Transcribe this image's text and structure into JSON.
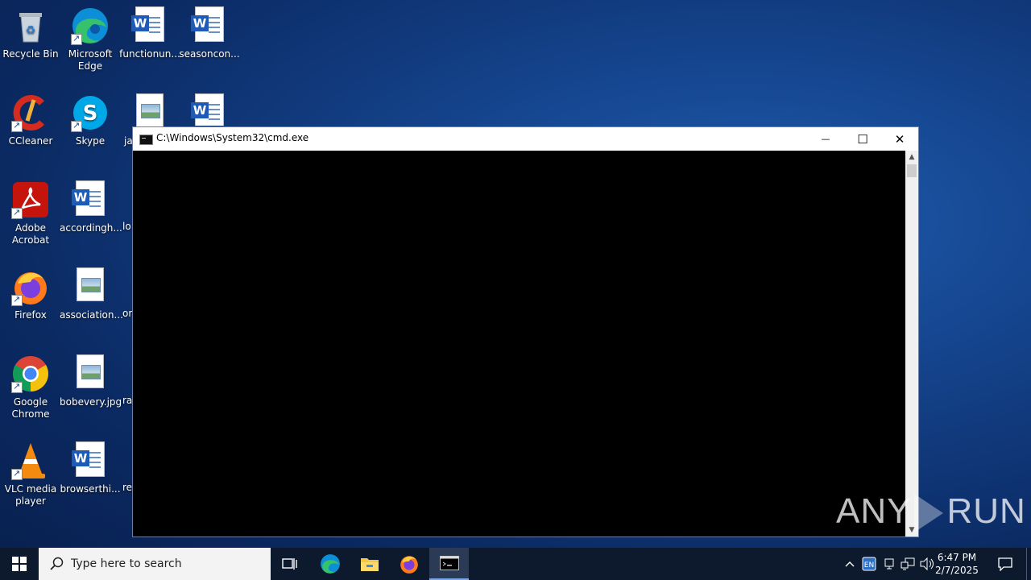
{
  "desktop": {
    "icons": [
      {
        "label": "Recycle Bin"
      },
      {
        "label": "Microsoft Edge"
      },
      {
        "label": "functionun..."
      },
      {
        "label": "seasoncon..."
      },
      {
        "label": "CCleaner"
      },
      {
        "label": "Skype"
      },
      {
        "label": "ja"
      },
      {
        "label": "Adobe Acrobat"
      },
      {
        "label": "accordingh..."
      },
      {
        "label": "lo"
      },
      {
        "label": "Firefox"
      },
      {
        "label": "association..."
      },
      {
        "label": "or"
      },
      {
        "label": "Google Chrome"
      },
      {
        "label": "bobevery.jpg"
      },
      {
        "label": "ra"
      },
      {
        "label": "VLC media player"
      },
      {
        "label": "browserthi..."
      },
      {
        "label": "re"
      }
    ]
  },
  "cmd_window": {
    "title": "C:\\Windows\\System32\\cmd.exe",
    "minimize_glyph": "—",
    "maximize_glyph": "☐",
    "close_glyph": "✕"
  },
  "watermark": {
    "left": "ANY",
    "right": "RUN"
  },
  "taskbar": {
    "search_placeholder": "Type here to search",
    "time": "6:47 PM",
    "date": "2/7/2025",
    "pinned": [
      "task-view-icon",
      "edge-icon",
      "file-explorer-icon",
      "firefox-icon",
      "cmd-icon"
    ],
    "tray": [
      "chevron-up-icon",
      "language-icon",
      "network-icon",
      "speaker-icon",
      "notification-icon"
    ]
  },
  "colors": {
    "accent": "#1f5bb6",
    "console": "#000000",
    "taskbar": "#0d1a2e"
  }
}
